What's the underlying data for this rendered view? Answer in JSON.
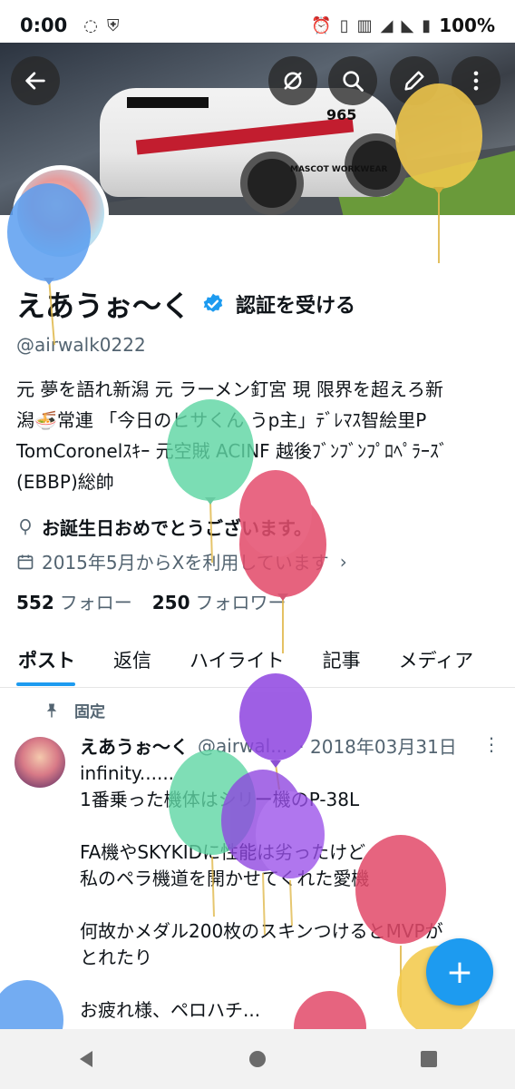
{
  "status_bar": {
    "time": "0:00",
    "battery": "100%"
  },
  "profile": {
    "name": "えあうぉ〜く",
    "verify_cta": "認証を受ける",
    "handle": "@airwalk0222",
    "bio_lines": [
      "元 夢を語れ新潟 元 ラーメン釘宮 現 限界を超えろ新",
      "潟🍜常連 「今日のヒサくん うp主」ﾃﾞﾚﾏｽ智絵里P",
      "TomCoronelｽｷｰ 元空賊 ACINF 越後ﾌﾞﾝﾌﾞﾝﾌﾟﾛﾍﾟﾗｰｽﾞ",
      "(EBBP)総帥"
    ],
    "birthday": "お誕生日おめでとうございます。",
    "joined": "2015年5月からXを利用しています",
    "following_count": "552",
    "following_label": "フォロー",
    "followers_count": "250",
    "followers_label": "フォロワー"
  },
  "banner": {
    "car_number": "965",
    "car_brand": "MASCOT WORKWEAR"
  },
  "tabs": [
    "ポスト",
    "返信",
    "ハイライト",
    "記事",
    "メディア"
  ],
  "pinned_label": "固定",
  "post": {
    "name": "えあうぉ〜く",
    "handle": "@airwal...",
    "date": "· 2018年03月31日",
    "body": "infinity......\n1番乗った機体はシリー機のP-38L\n\nFA機やSKYKIDに性能は劣ったけど\n私のペラ機道を開かせてくれた愛機\n\n何故かメダル200枚のスキンつけるとMVPが\nとれたり\n\nお疲れ様、ペロハチ..."
  },
  "fab_label": "+",
  "icons": {
    "back": "arrow-left-icon",
    "hide": "eye-off-icon",
    "search": "search-icon",
    "edit": "pencil-icon",
    "more": "more-vertical-icon",
    "verified": "verified-badge-icon",
    "birthday": "balloon-icon",
    "calendar": "calendar-icon",
    "pin": "pin-icon"
  },
  "colors": {
    "accent": "#1d9bf0",
    "secondary_text": "#536471",
    "balloon_yellow": "#f2c94c",
    "balloon_blue": "#5b9ef0",
    "balloon_green": "#5fd6a4",
    "balloon_red": "#e24a6a",
    "balloon_purple": "#8e44e0"
  }
}
